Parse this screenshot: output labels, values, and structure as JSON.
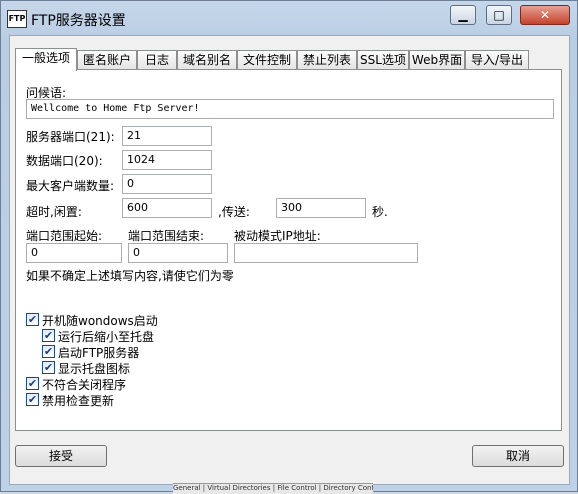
{
  "window": {
    "app_icon": "FTP",
    "title": "FTP服务器设置",
    "min_glyph": "▁",
    "max_glyph": "□",
    "close_glyph": "✕"
  },
  "tabs": [
    {
      "label": "一般选项",
      "active": true
    },
    {
      "label": "匿名账户"
    },
    {
      "label": "日志"
    },
    {
      "label": "域名别名"
    },
    {
      "label": "文件控制"
    },
    {
      "label": "禁止列表"
    },
    {
      "label": "SSL选项"
    },
    {
      "label": "Web界面"
    },
    {
      "label": "导入/导出"
    }
  ],
  "general": {
    "greeting_label": "问候语:",
    "greeting_value": "Wellcome to Home Ftp Server!",
    "server_port_label": "服务器端口(21):",
    "server_port_value": "21",
    "data_port_label": "数据端口(20):",
    "data_port_value": "1024",
    "max_clients_label": "最大客户端数量:",
    "max_clients_value": "0",
    "timeout_idle_label": "超时,闲置:",
    "timeout_idle_value": "600",
    "timeout_transfer_label": ",传送:",
    "timeout_transfer_value": "300",
    "seconds_label": "秒.",
    "port_range_start_label": "端口范围起始:",
    "port_range_start_value": "0",
    "port_range_end_label": "端口范围结束:",
    "port_range_end_value": "0",
    "passive_ip_label": "被动模式IP地址:",
    "passive_ip_value": "",
    "hint": "如果不确定上述填写内容,请使它们为零"
  },
  "checkboxes": {
    "start_with_windows": {
      "label": "开机随wondows启动",
      "checked": true
    },
    "minimize_to_tray": {
      "label": "运行后缩小至托盘",
      "checked": true
    },
    "start_ftp_server": {
      "label": "启动FTP服务器",
      "checked": true
    },
    "show_tray_icon": {
      "label": "显示托盘图标",
      "checked": true
    },
    "no_close_program": {
      "label": "不符合关闭程序",
      "checked": true
    },
    "disable_update_check": {
      "label": "禁用检查更新",
      "checked": true
    },
    "check_glyph": "✔"
  },
  "buttons": {
    "accept": "接受",
    "cancel": "取消"
  },
  "background_window": {
    "tabs_text": "General | Virtual Directories | File Control | Directory Control"
  }
}
